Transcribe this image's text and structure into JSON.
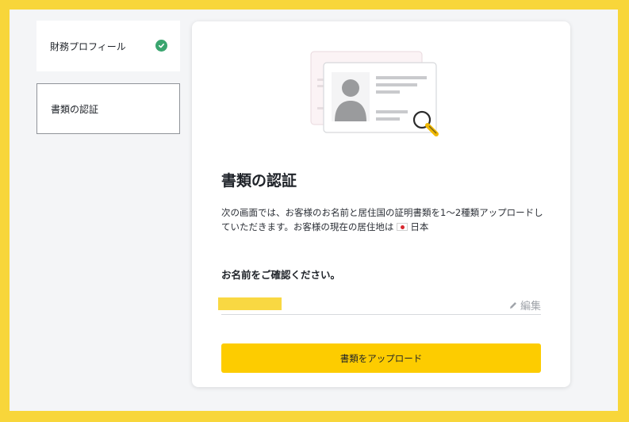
{
  "steps": [
    {
      "label": "財務プロフィール",
      "completed": true
    },
    {
      "label": "書類の認証",
      "completed": false
    }
  ],
  "main": {
    "title": "書類の認証",
    "description": "次の画面では、お客様のお名前と居住国の証明書類を1～2種類アップロードしていただきます。お客様の現在の居住地は",
    "residence_country": "日本",
    "confirm_heading": "お名前をご確認ください。",
    "edit_label": "編集",
    "upload_button": "書類をアップロード"
  },
  "colors": {
    "background": "#f8d63a",
    "accent_button": "#fdcc00",
    "check_green": "#3aa56f"
  }
}
